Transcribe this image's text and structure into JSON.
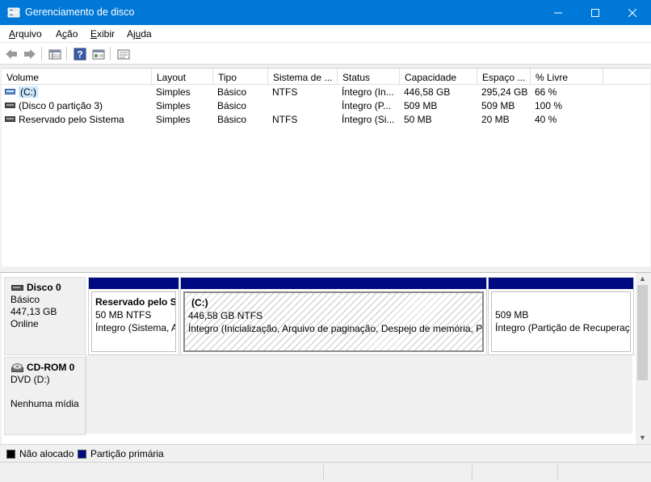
{
  "window": {
    "title": "Gerenciamento de disco",
    "minimize_glyph": "—",
    "maximize_glyph": "☐",
    "close_glyph": "✕"
  },
  "menu": {
    "items": [
      {
        "label_first": "A",
        "label_rest": "rquivo"
      },
      {
        "label_first": "Ação",
        "label_rest": ""
      },
      {
        "label_first": "Exibir",
        "label_rest": ""
      },
      {
        "label_first": "Ajuda",
        "label_rest": ""
      }
    ],
    "arquivo_u": "A",
    "arquivo_rest": "rquivo",
    "acao_pre": "A",
    "acao_u": "ç",
    "acao_rest": "ão",
    "exibir_u": "E",
    "exibir_rest": "xibir",
    "ajuda_pre": "Aj",
    "ajuda_u": "u",
    "ajuda_rest": "da"
  },
  "toolbar": {
    "icons": [
      "back-icon",
      "forward-icon",
      "list-view-icon",
      "help-icon",
      "properties-icon",
      "console-icon"
    ],
    "help_glyph": "?"
  },
  "volume_list": {
    "columns": [
      "Volume",
      "Layout",
      "Tipo",
      "Sistema de ...",
      "Status",
      "Capacidade",
      "Espaço ...",
      "% Livre"
    ],
    "rows": [
      {
        "volume": "(C:)",
        "layout": "Simples",
        "tipo": "Básico",
        "sistema": "NTFS",
        "status": "Íntegro (In...",
        "capacidade": "446,58 GB",
        "espaco": "295,24 GB",
        "livre": "66 %"
      },
      {
        "volume": "(Disco 0 partição 3)",
        "layout": "Simples",
        "tipo": "Básico",
        "sistema": "",
        "status": "Íntegro (P...",
        "capacidade": "509 MB",
        "espaco": "509 MB",
        "livre": "100 %"
      },
      {
        "volume": "Reservado pelo Sistema",
        "layout": "Simples",
        "tipo": "Básico",
        "sistema": "NTFS",
        "status": "Íntegro (Si...",
        "capacidade": "50 MB",
        "espaco": "20 MB",
        "livre": "40 %"
      }
    ]
  },
  "disks": {
    "disk0": {
      "name": "Disco 0",
      "type": "Básico",
      "size": "447,13 GB",
      "state": "Online",
      "partitions": [
        {
          "name": "Reservado pelo Si",
          "size": "50 MB NTFS",
          "status": "Íntegro (Sistema, A"
        },
        {
          "name": "(C:)",
          "size": "446,58 GB NTFS",
          "status": "Íntegro (Inicialização, Arquivo de paginação, Despejo de memória, Pa"
        },
        {
          "name": "",
          "size": "509 MB",
          "status": "Íntegro (Partição de Recuperaçã"
        }
      ]
    },
    "cdrom0": {
      "name": "CD-ROM 0",
      "drive": "DVD (D:)",
      "media": "Nenhuma mídia"
    }
  },
  "legend": {
    "items": [
      {
        "label": "Não alocado",
        "color": "#000000"
      },
      {
        "label": "Partição primária",
        "color": "#000a80"
      }
    ]
  },
  "colors": {
    "titlebar": "#0078d7",
    "primary_partition": "#000a80",
    "unallocated": "#000000"
  }
}
